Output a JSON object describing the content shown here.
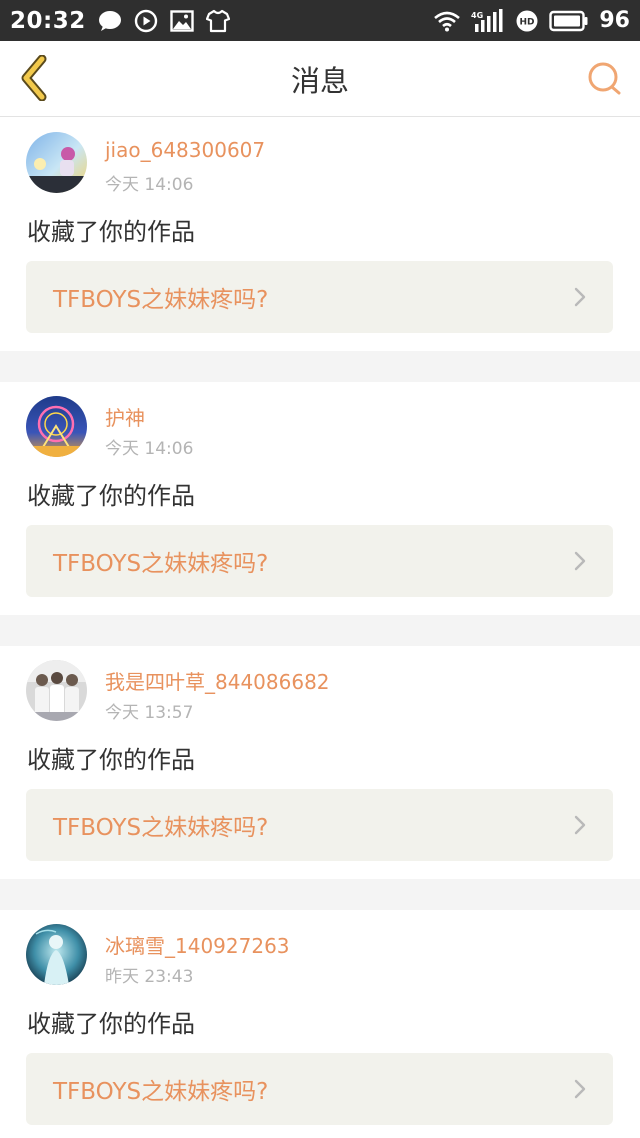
{
  "status_bar": {
    "time": "20:32",
    "network": "4G",
    "battery": "96",
    "icons_left": [
      "chat-bubble-icon",
      "play-circle-icon",
      "gallery-icon",
      "tshirt-icon"
    ],
    "icons_right": [
      "wifi-icon",
      "signal-icon",
      "hd-icon",
      "battery-icon"
    ]
  },
  "header": {
    "title": "消息",
    "back_icon": "chevron-left-icon",
    "search_icon": "search-icon"
  },
  "colors": {
    "accent": "#e8925e",
    "back_icon_fill": "#f2c94c",
    "card_link_bg": "#f2f2ec",
    "divider_bg": "#f4f4f4"
  },
  "messages": [
    {
      "username": "jiao_648300607",
      "time": "今天 14:06",
      "action": "收藏了你的作品",
      "work_title": "TFBOYS之妹妹疼吗?"
    },
    {
      "username": "护神",
      "time": "今天 14:06",
      "action": "收藏了你的作品",
      "work_title": "TFBOYS之妹妹疼吗?"
    },
    {
      "username": "我是四叶草_844086682",
      "time": "今天 13:57",
      "action": "收藏了你的作品",
      "work_title": "TFBOYS之妹妹疼吗?"
    },
    {
      "username": "冰璃雪_140927263",
      "time": "昨天 23:43",
      "action": "收藏了你的作品",
      "work_title": "TFBOYS之妹妹疼吗?"
    }
  ]
}
